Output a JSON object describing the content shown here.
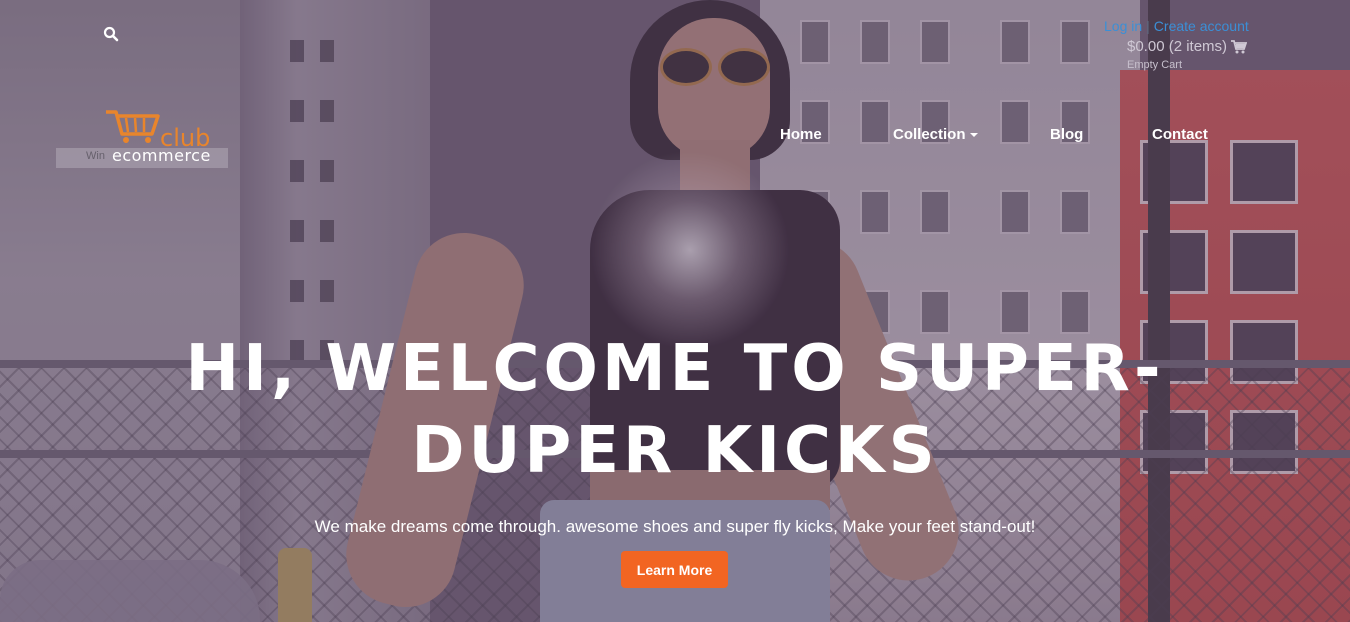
{
  "header": {
    "login_label": "Log in",
    "create_account_label": "Create account",
    "cart_summary": "$0.00 (2 items)",
    "empty_cart_label": "Empty Cart"
  },
  "logo": {
    "word_club": "club",
    "word_ecommerce": "ecommerce",
    "ghost_text": "Win"
  },
  "nav": {
    "items": [
      {
        "label": "Home"
      },
      {
        "label": "Collection"
      },
      {
        "label": "Blog"
      },
      {
        "label": "Contact"
      }
    ]
  },
  "hero": {
    "title": "HI, WELCOME TO SUPER-DUPER KICKS",
    "subtitle": "We make dreams come through. awesome shoes and super fly kicks, Make your feet stand-out!",
    "cta_label": "Learn More"
  },
  "icons": {
    "search": "search-icon",
    "cart": "shopping-cart-icon",
    "logo": "logo-cart-icon"
  },
  "colors": {
    "accent": "#f26522",
    "logo_orange": "#e8852c",
    "link_blue": "#3b8fd6",
    "overlay": "#604868"
  }
}
